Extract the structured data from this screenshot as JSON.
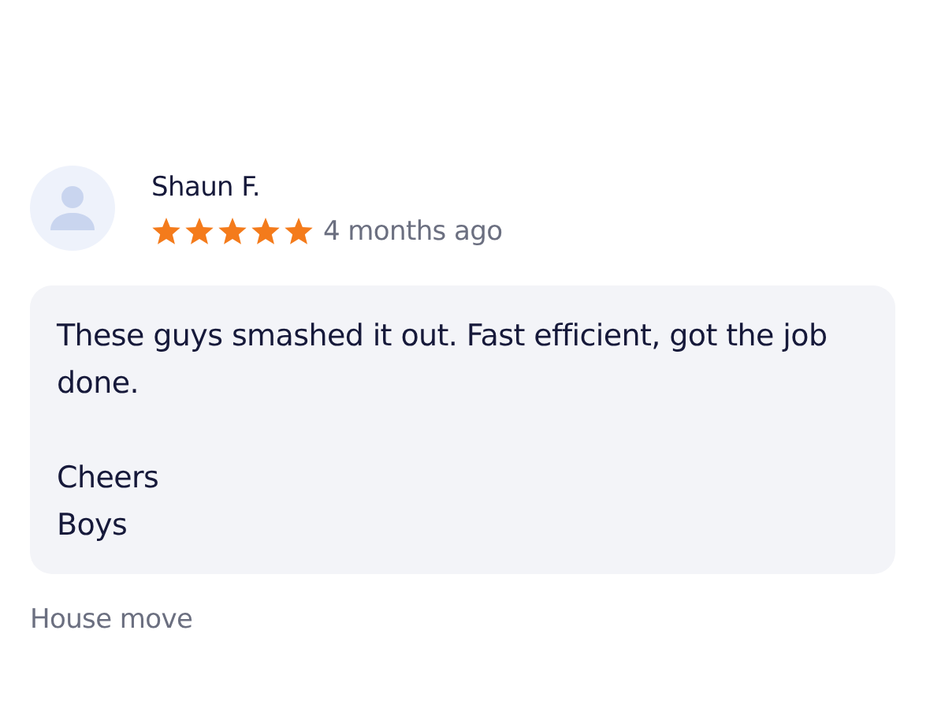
{
  "review": {
    "author": "Shaun F.",
    "stars": 5,
    "time": "4 months ago",
    "text": "These guys smashed it out. Fast efficient, got the job done.\n\nCheers\nBoys",
    "category": "House move"
  }
}
